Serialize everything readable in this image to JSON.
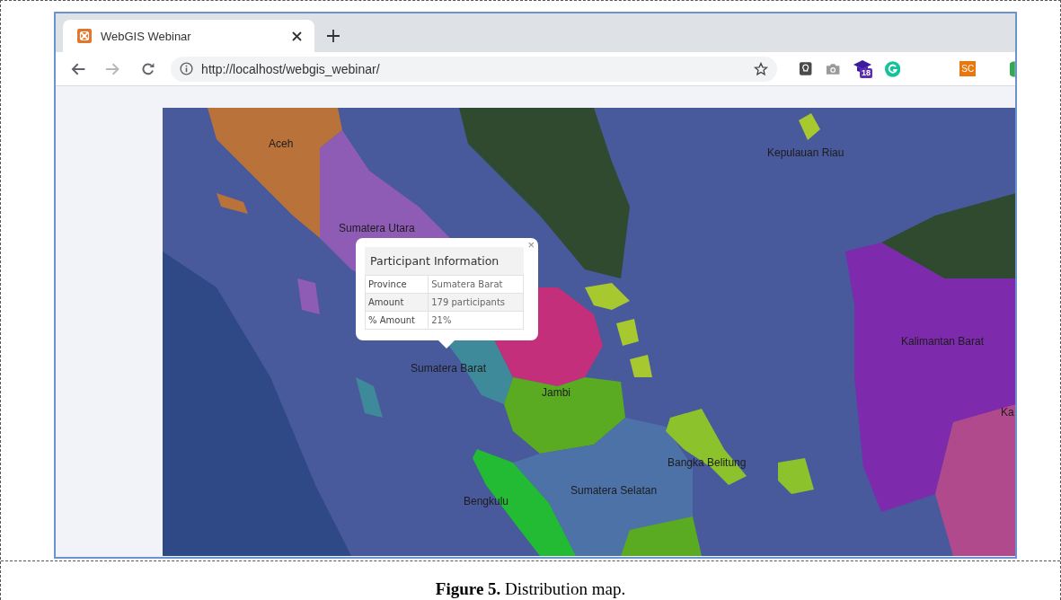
{
  "browser": {
    "tabs": [
      {
        "title": "WebGIS Webinar",
        "selected": true
      }
    ],
    "address": "http://localhost/webgis_webinar/",
    "extension_badge": "18",
    "extension_label": "SC"
  },
  "map": {
    "labels": [
      {
        "text": "Aceh"
      },
      {
        "text": "Sumatera Utara"
      },
      {
        "text": "Kepulauan Riau"
      },
      {
        "text": "Kalimantan Barat"
      },
      {
        "text": "Sumatera Barat"
      },
      {
        "text": "Jambi"
      },
      {
        "text": "Bangka Belitung"
      },
      {
        "text": "Sumatera Selatan"
      },
      {
        "text": "Bengkulu"
      },
      {
        "text": "Ka"
      }
    ],
    "popup": {
      "title": "Participant Information",
      "close": "×",
      "rows": [
        {
          "label": "Province",
          "value": "Sumatera Barat"
        },
        {
          "label": "Amount",
          "value": "179 participants"
        },
        {
          "label": "% Amount",
          "value": "21%"
        }
      ]
    }
  },
  "caption": "**Figure 5.** Distribution map."
}
